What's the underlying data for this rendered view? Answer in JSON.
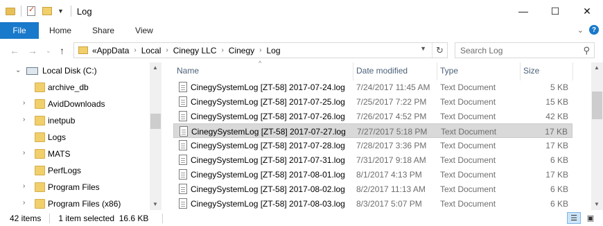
{
  "window": {
    "title": "Log",
    "controls": {
      "minimize": "—",
      "maximize": "☐",
      "close": "✕"
    }
  },
  "ribbon": {
    "file_label": "File",
    "tabs": [
      "Home",
      "Share",
      "View"
    ],
    "help": "?"
  },
  "address": {
    "breadcrumbs": [
      "«AppData",
      "Local",
      "Cinegy LLC",
      "Cinegy",
      "Log"
    ],
    "search_placeholder": "Search Log"
  },
  "nav_tree": [
    {
      "label": "Local Disk (C:)",
      "kind": "drive",
      "expanded": true
    },
    {
      "label": "archive_db",
      "kind": "folder",
      "has_children": false
    },
    {
      "label": "AvidDownloads",
      "kind": "folder",
      "has_children": true
    },
    {
      "label": "inetpub",
      "kind": "folder",
      "has_children": true
    },
    {
      "label": "Logs",
      "kind": "folder",
      "has_children": false
    },
    {
      "label": "MATS",
      "kind": "folder",
      "has_children": true
    },
    {
      "label": "PerfLogs",
      "kind": "folder",
      "has_children": false
    },
    {
      "label": "Program Files",
      "kind": "folder",
      "has_children": true
    },
    {
      "label": "Program Files (x86)",
      "kind": "folder",
      "has_children": true
    }
  ],
  "columns": {
    "name": "Name",
    "date": "Date modified",
    "type": "Type",
    "size": "Size"
  },
  "files": [
    {
      "name": "CinegySystemLog [ZT-58] 2017-07-24.log",
      "date": "7/24/2017 11:45 AM",
      "type": "Text Document",
      "size": "5 KB",
      "selected": false
    },
    {
      "name": "CinegySystemLog [ZT-58] 2017-07-25.log",
      "date": "7/25/2017 7:22 PM",
      "type": "Text Document",
      "size": "15 KB",
      "selected": false
    },
    {
      "name": "CinegySystemLog [ZT-58] 2017-07-26.log",
      "date": "7/26/2017 4:52 PM",
      "type": "Text Document",
      "size": "42 KB",
      "selected": false
    },
    {
      "name": "CinegySystemLog [ZT-58] 2017-07-27.log",
      "date": "7/27/2017 5:18 PM",
      "type": "Text Document",
      "size": "17 KB",
      "selected": true
    },
    {
      "name": "CinegySystemLog [ZT-58] 2017-07-28.log",
      "date": "7/28/2017 3:36 PM",
      "type": "Text Document",
      "size": "17 KB",
      "selected": false
    },
    {
      "name": "CinegySystemLog [ZT-58] 2017-07-31.log",
      "date": "7/31/2017 9:18 AM",
      "type": "Text Document",
      "size": "6 KB",
      "selected": false
    },
    {
      "name": "CinegySystemLog [ZT-58] 2017-08-01.log",
      "date": "8/1/2017 4:13 PM",
      "type": "Text Document",
      "size": "17 KB",
      "selected": false
    },
    {
      "name": "CinegySystemLog [ZT-58] 2017-08-02.log",
      "date": "8/2/2017 11:13 AM",
      "type": "Text Document",
      "size": "6 KB",
      "selected": false
    },
    {
      "name": "CinegySystemLog [ZT-58] 2017-08-03.log",
      "date": "8/3/2017 5:07 PM",
      "type": "Text Document",
      "size": "6 KB",
      "selected": false
    }
  ],
  "status": {
    "items": "42 items",
    "selection": "1 item selected  16.6 KB"
  },
  "colors": {
    "accent": "#1979ca",
    "selection": "#d9d9d9",
    "column_header": "#4c607a",
    "folder": "#f1cf6b"
  }
}
